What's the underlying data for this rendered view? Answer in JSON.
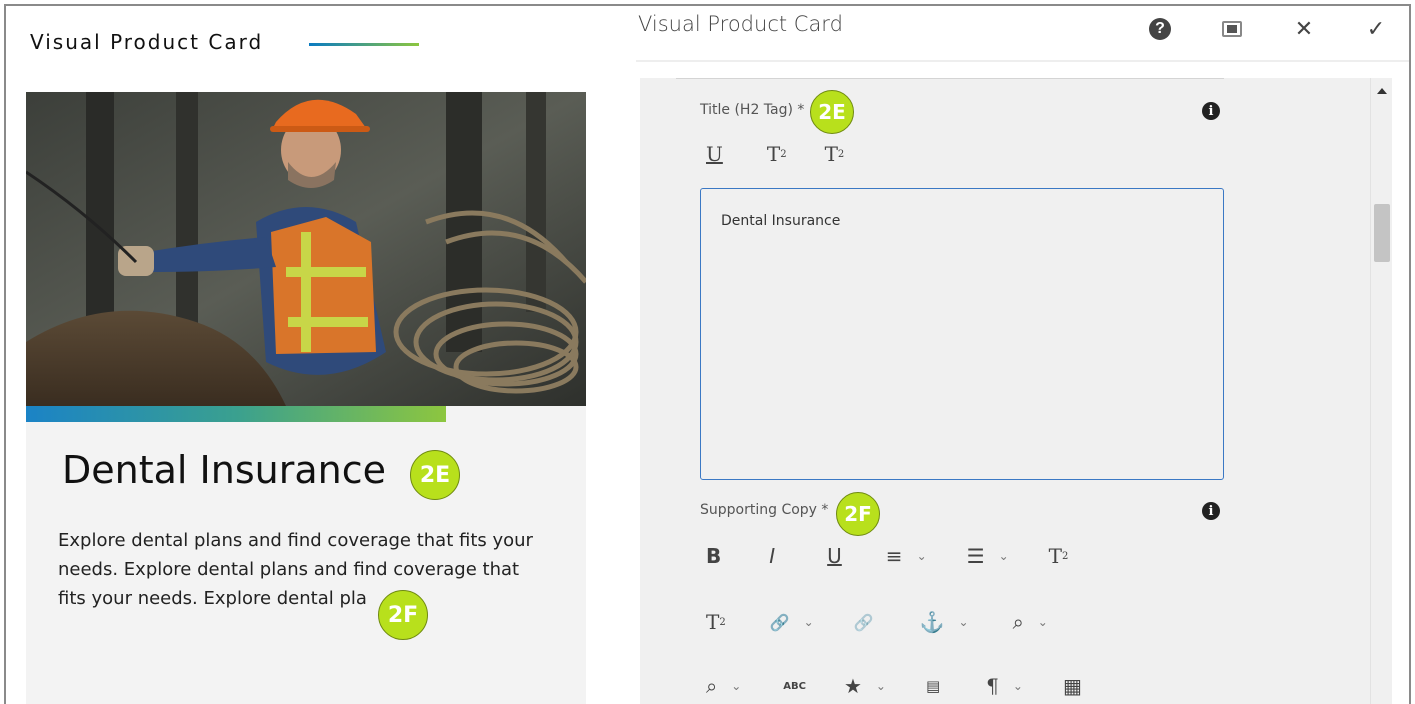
{
  "preview": {
    "header_title": "Visual Product Card",
    "card_heading": "Dental Insurance",
    "card_body": "Explore dental plans and find coverage that fits your needs. Explore dental plans and find coverage that fits your needs. Explore dental pla",
    "accent_gradient": [
      "#1b83c6",
      "#8dc63f"
    ]
  },
  "badges": {
    "title_badge": "2E",
    "copy_badge": "2F",
    "color": "#b8e01c"
  },
  "dialog": {
    "title": "Visual Product Card",
    "help_icon": "help-icon",
    "fullscreen_icon": "fullscreen-icon",
    "close_glyph": "✕",
    "confirm_glyph": "✓"
  },
  "fields": {
    "title": {
      "label": "Title (H2 Tag) *",
      "value": "Dental Insurance",
      "info_glyph": "i",
      "toolbar": [
        "underline",
        "subscript",
        "superscript"
      ]
    },
    "supporting_copy": {
      "label": "Supporting Copy *",
      "info_glyph": "i",
      "toolbar_row1": [
        "bold",
        "italic",
        "underline",
        "align",
        "list",
        "subscript"
      ],
      "toolbar_row2": [
        "superscript",
        "link",
        "unlink",
        "anchor",
        "find"
      ],
      "toolbar_row3": [
        "find-replace",
        "spellcheck",
        "special-characters",
        "source-edit",
        "paragraph-format",
        "table"
      ]
    }
  },
  "toolbar_glyphs": {
    "bold": "B",
    "italic": "I",
    "underline": "U",
    "align": "≡",
    "list": "☰",
    "T": "T",
    "sub": "2",
    "sup": "2",
    "link": "🔗",
    "anchor": "⚓",
    "find": "⌕",
    "spell": "ABC",
    "star": "★",
    "para": "¶",
    "table": "▦",
    "caret": "⌄"
  }
}
